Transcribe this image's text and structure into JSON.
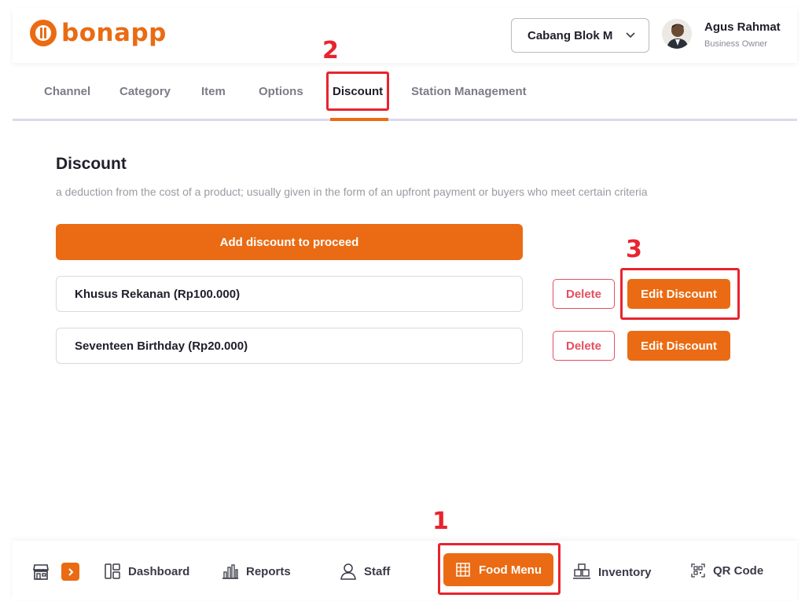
{
  "brand": {
    "name": "bonapp"
  },
  "header": {
    "branch": "Cabang Blok M",
    "user_name": "Agus Rahmat",
    "user_role": "Business Owner"
  },
  "tabs": [
    {
      "label": "Channel"
    },
    {
      "label": "Category"
    },
    {
      "label": "Item"
    },
    {
      "label": "Options"
    },
    {
      "label": "Discount",
      "active": true
    },
    {
      "label": "Station Management"
    }
  ],
  "page": {
    "title": "Discount",
    "subtitle": "a deduction from the cost of a product; usually given in the form of an upfront payment or buyers who meet certain criteria",
    "add_label": "Add discount to proceed"
  },
  "discounts": [
    {
      "name": "Khusus Rekanan (Rp100.000)",
      "delete_label": "Delete",
      "edit_label": "Edit Discount"
    },
    {
      "name": "Seventeen Birthday (Rp20.000)",
      "delete_label": "Delete",
      "edit_label": "Edit Discount"
    }
  ],
  "bottom_nav": {
    "items": [
      {
        "label": "Dashboard",
        "icon": "dashboard-icon"
      },
      {
        "label": "Reports",
        "icon": "reports-icon"
      },
      {
        "label": "Staff",
        "icon": "staff-icon"
      },
      {
        "label": "Food Menu",
        "icon": "food-menu-icon",
        "active": true
      },
      {
        "label": "Inventory",
        "icon": "inventory-icon"
      },
      {
        "label": "QR Code",
        "icon": "qr-code-icon"
      }
    ]
  },
  "annotations": [
    "1",
    "2",
    "3"
  ],
  "colors": {
    "accent": "#ea6b13",
    "danger": "#e4505f",
    "annotation": "#e8242e"
  }
}
